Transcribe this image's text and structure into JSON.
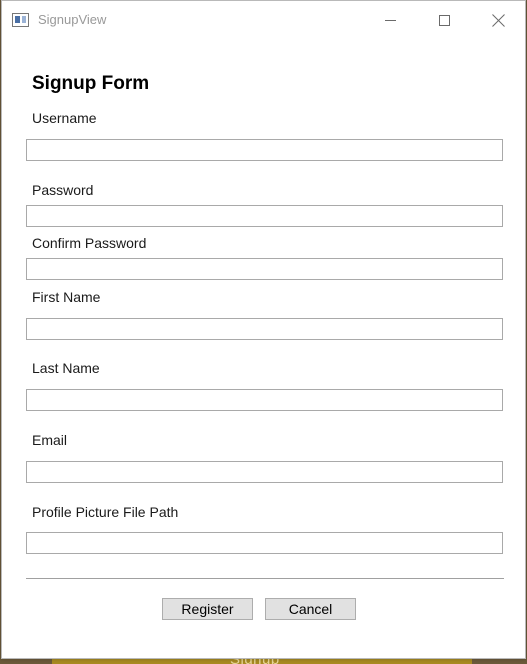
{
  "window": {
    "title": "SignupView",
    "icon": "app-window-icon",
    "controls": {
      "minimize": "minimize-icon",
      "maximize": "maximize-icon",
      "close": "close-icon"
    }
  },
  "form": {
    "heading": "Signup Form",
    "fields": [
      {
        "label": "Username",
        "value": "",
        "placeholder": ""
      },
      {
        "label": "Password",
        "value": "",
        "placeholder": ""
      },
      {
        "label": "Confirm Password",
        "value": "",
        "placeholder": ""
      },
      {
        "label": "First Name",
        "value": "",
        "placeholder": ""
      },
      {
        "label": "Last Name",
        "value": "",
        "placeholder": ""
      },
      {
        "label": "Email",
        "value": "",
        "placeholder": ""
      },
      {
        "label": "Profile Picture File Path",
        "value": "",
        "placeholder": ""
      }
    ],
    "buttons": {
      "register": "Register",
      "cancel": "Cancel"
    }
  },
  "background_app": {
    "partial_text": "Signup"
  },
  "colors": {
    "window_bg": "#ffffff",
    "button_bg": "#e1e1e1",
    "border": "#a9a9a9",
    "background_app_gold": "#a88a22"
  }
}
